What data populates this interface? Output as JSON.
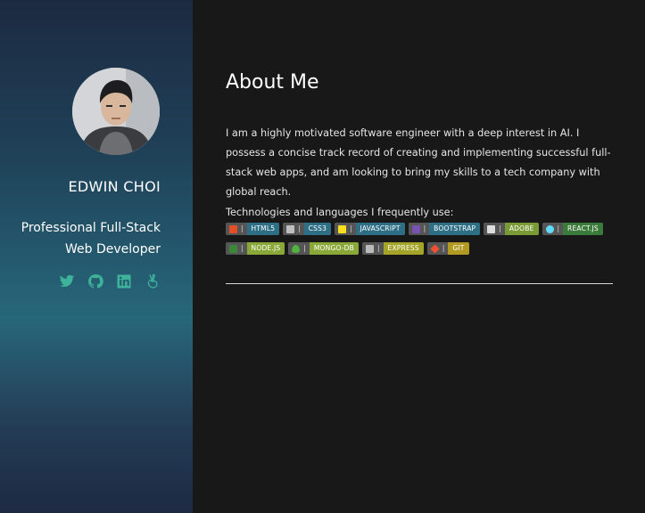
{
  "profile": {
    "name": "EDWIN CHOI",
    "tagline": "Professional Full-Stack Web Developer",
    "socials": [
      {
        "icon": "twitter-icon",
        "color": "#3eb39a"
      },
      {
        "icon": "github-icon",
        "color": "#3eb39a"
      },
      {
        "icon": "linkedin-icon",
        "color": "#3eb39a"
      },
      {
        "icon": "angellist-icon",
        "color": "#3eb39a"
      }
    ]
  },
  "about": {
    "title": "About Me",
    "text": "I am a highly motivated software engineer with a deep interest in AI. I possess a concise track record of creating and implementing successful full-stack web apps, and am looking to bring my skills to a tech company with global reach.",
    "tech_label": "Technologies and languages I frequently use:"
  },
  "badges": [
    {
      "label": "HTML5",
      "icon": "html5-icon",
      "icon_color": "#e34f26",
      "color": "#2f6f86"
    },
    {
      "label": "CSS3",
      "icon": "css3-icon",
      "icon_color": "#bfbfbf",
      "color": "#2f6f86"
    },
    {
      "label": "JAVASCRIPT",
      "icon": "javascript-icon",
      "icon_color": "#f7df1e",
      "color": "#2f6f86"
    },
    {
      "label": "BOOTSTRAP",
      "icon": "bootstrap-icon",
      "icon_color": "#7952b3",
      "color": "#2f6f86"
    },
    {
      "label": "ADOBE",
      "icon": "adobe-icon",
      "icon_color": "#dddddd",
      "color": "#7a9a35"
    },
    {
      "label": "REACT.JS",
      "icon": "react-icon",
      "icon_color": "#61dafb",
      "color": "#3a7a3a"
    },
    {
      "label": "NODE.JS",
      "icon": "nodejs-icon",
      "icon_color": "#3c873a",
      "color": "#8aa838"
    },
    {
      "label": "MONGO-DB",
      "icon": "mongodb-icon",
      "icon_color": "#4db33d",
      "color": "#8aa838"
    },
    {
      "label": "EXPRESS",
      "icon": "express-icon",
      "icon_color": "#bbbbbb",
      "color": "#a4a428"
    },
    {
      "label": "GIT",
      "icon": "git-icon",
      "icon_color": "#f05032",
      "color": "#b29a22"
    }
  ]
}
